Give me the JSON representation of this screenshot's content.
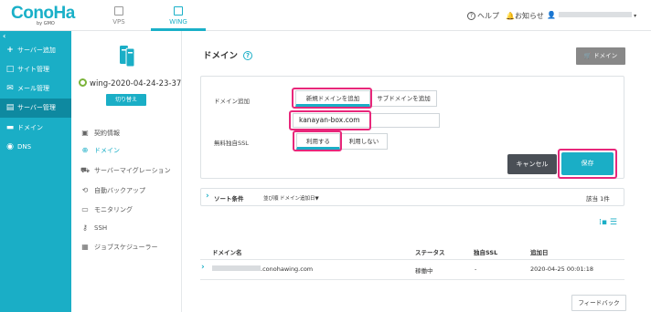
{
  "brand": {
    "logo": "ConoHa",
    "sub": "by GMO"
  },
  "top_tabs": [
    {
      "label": "VPS"
    },
    {
      "label": "WING"
    }
  ],
  "top_links": {
    "help": "ヘルプ",
    "notice": "お知らせ"
  },
  "sidebar": {
    "items": [
      {
        "icon": "plus-icon",
        "label": "サーバー追加"
      },
      {
        "icon": "window-icon",
        "label": "サイト管理"
      },
      {
        "icon": "mail-icon",
        "label": "メール管理"
      },
      {
        "icon": "server-icon",
        "label": "サーバー管理"
      },
      {
        "icon": "domain-icon",
        "label": "ドメイン"
      },
      {
        "icon": "globe-icon",
        "label": "DNS"
      }
    ],
    "active": "サーバー管理"
  },
  "server": {
    "name": "wing-2020-04-24-23-37",
    "switch_label": "切り替え",
    "status": "ok"
  },
  "server_menu": [
    {
      "icon": "doc-icon",
      "label": "契約情報"
    },
    {
      "icon": "globe-icon",
      "label": "ドメイン",
      "active": true
    },
    {
      "icon": "truck-icon",
      "label": "サーバーマイグレーション"
    },
    {
      "icon": "backup-icon",
      "label": "自動バックアップ"
    },
    {
      "icon": "monitor-icon",
      "label": "モニタリング"
    },
    {
      "icon": "key-icon",
      "label": "SSH"
    },
    {
      "icon": "calendar-icon",
      "label": "ジョブスケジューラー"
    }
  ],
  "page": {
    "title": "ドメイン",
    "help_icon": "?",
    "add_button": "ドメイン"
  },
  "form": {
    "domain_add_label": "ドメイン追加",
    "new_domain_btn": "新規ドメインを追加",
    "subdomain_btn": "サブドメインを追加",
    "domain_value": "kanayan-box.com",
    "ssl_label": "無料独自SSL",
    "ssl_on": "利用する",
    "ssl_off": "利用しない",
    "cancel": "キャンセル",
    "save": "保存"
  },
  "sort": {
    "title": "ソート条件",
    "order_label": "並び順",
    "order_value": "ドメイン追加日▼",
    "count_text": "該当 1件"
  },
  "table": {
    "columns": [
      "ドメイン名",
      "ステータス",
      "独自SSL",
      "追加日"
    ],
    "rows": [
      {
        "domain_suffix": ".conohawing.com",
        "status": "稼働中",
        "ssl": "-",
        "date": "2020-04-25 00:01:18"
      }
    ]
  },
  "feedback": "フィードバック",
  "colors": {
    "accent": "#1aaec6",
    "highlight": "#e8277a",
    "sidebar": "#1aaec6",
    "sidebar_active": "#0e89a0"
  }
}
